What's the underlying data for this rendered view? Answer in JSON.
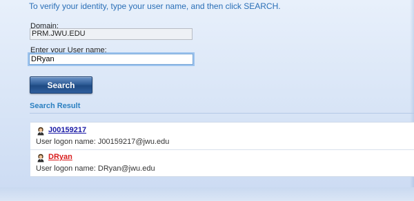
{
  "instruction": "To verify your identity, type your user name, and then click SEARCH.",
  "domain": {
    "label": "Domain:",
    "value": "PRM.JWU.EDU"
  },
  "username": {
    "label": "Enter your User name:",
    "value": "DRyan"
  },
  "search_button": {
    "label": "Search"
  },
  "results": {
    "heading": "Search Result",
    "items": [
      {
        "name": "J00159217",
        "logon": "User logon name: J00159217@jwu.edu",
        "icon": "user-icon",
        "link_color": "#1a1aa6"
      },
      {
        "name": "DRyan",
        "logon": "User logon name: DRyan@jwu.edu",
        "icon": "user-icon",
        "link_color": "#d81b1b"
      }
    ]
  },
  "colors": {
    "accent": "#2a6fb7",
    "button": "#2f5d98"
  }
}
